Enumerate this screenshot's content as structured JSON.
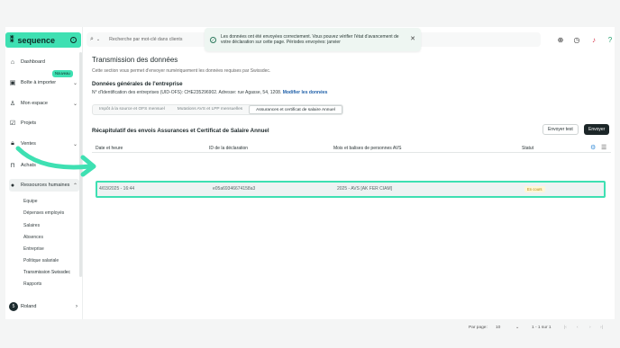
{
  "brand": {
    "name": "sequence",
    "accent": "#3ee0b2"
  },
  "sidebar": {
    "items": [
      {
        "label": "Dashboard",
        "icon": "home-icon"
      },
      {
        "label": "Boîte à importer",
        "icon": "inbox-icon"
      },
      {
        "label": "Mon espace",
        "icon": "user-icon"
      },
      {
        "label": "Projets",
        "icon": "checkbox-icon"
      },
      {
        "label": "Ventes",
        "icon": "lock-icon"
      },
      {
        "label": "Achats",
        "icon": "bag-icon"
      },
      {
        "label": "Ressources humaines",
        "icon": "people-icon"
      }
    ],
    "badge_new": "Nouveau",
    "sub_items": [
      "Equipe",
      "Dépenses employés",
      "Salaires",
      "Absences",
      "Entreprise",
      "Politique salariale",
      "Transmission Swissdec",
      "Rapports"
    ],
    "user_name": "Roland",
    "user_badge": "5"
  },
  "topbar": {
    "search_placeholder": "Recherche par mot-clé dans clients",
    "toast_text": "Les données ont été envoyées correctement. Vous pouvez vérifier l'état d'avancement de votre déclaration sur cette page. Périodes envoyées: janvier"
  },
  "main": {
    "title": "Transmission des données",
    "description": "Cette section vous permet d'envoyer numériquement les données requises par Swissdec.",
    "section_title": "Données générales de l'entreprise",
    "company_line": "N° d'Identification des entreprises (UID-OFS): CHE235296902. Adresse: rue Agasse, 54, 1208.",
    "company_link": "Modifier les données",
    "tabs": [
      "Impôt à la source et OFS mensuel",
      "Mutations AVS et LPP mensuelles",
      "Assurances et certificat de salaire Annuel"
    ],
    "recap_title": "Récapitulatif des envois Assurances et Certificat de Salaire Annuel",
    "btn_test": "Envoyer test",
    "btn_send": "Envoyer",
    "table": {
      "headers": [
        "Date et heure",
        "ID de la déclaration",
        "Mois et balises de personnes AVS",
        "Statut"
      ],
      "row": {
        "date": "4/03/2025 - 16:44",
        "id": "e05a69346674158a3",
        "months": "2025 - AVS [AK FER CIAM]",
        "status": "En cours"
      }
    },
    "pager": {
      "per_page_label": "Par page:",
      "per_page_value": "10",
      "range": "1 - 1 sur 1"
    }
  }
}
